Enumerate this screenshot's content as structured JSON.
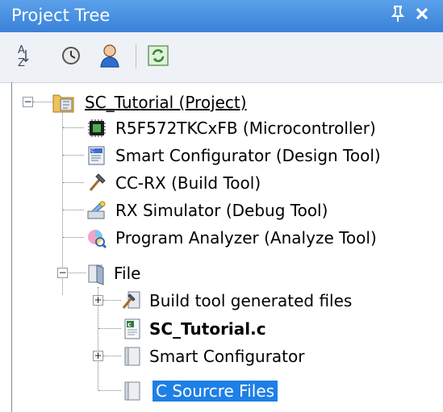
{
  "window": {
    "title": "Project Tree",
    "pin_glyph": "p",
    "close_glyph": "✕"
  },
  "toolbar": {
    "buttons": [
      {
        "icon": "sort-alphabetical-icon"
      },
      {
        "icon": "clock-icon"
      },
      {
        "icon": "user-icon"
      },
      {
        "icon": "refresh-icon"
      }
    ]
  },
  "tree": {
    "project": "SC_Tutorial (Project)",
    "microcontroller": "R5F572TKCxFB (Microcontroller)",
    "design_tool": "Smart Configurator (Design Tool)",
    "build_tool": "CC-RX (Build Tool)",
    "debug_tool": "RX Simulator (Debug Tool)",
    "analyze_tool": "Program Analyzer (Analyze Tool)",
    "file": "File",
    "generated_files": "Build tool generated files",
    "source_file": "SC_Tutorial.c",
    "smart_configurator": "Smart Configurator",
    "c_source_files": "C Sourcre Files"
  },
  "colors": {
    "titlebar": "#3a82d8",
    "selection": "#1e7fe6"
  }
}
